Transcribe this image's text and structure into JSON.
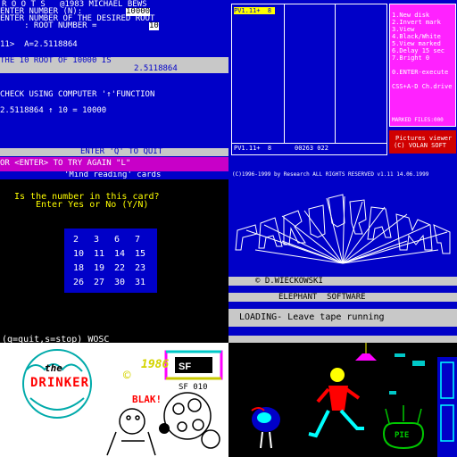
{
  "roots": {
    "title": "R O O T S   @1983 MICHAEL BEWS",
    "line_n_label": "ENTER NUMBER (N):",
    "line_n_value": "10000",
    "line_root_label": "ENTER NUMBER OF THE DESIRED ROOT",
    "line_root_label2": "     : ROOT NUMBER =",
    "line_root_value": "10",
    "result_line": "11>  A=2.5118864",
    "band1": "THE 10 ROOT OF 10000 IS",
    "band2": "2.5118864",
    "check": "CHECK USING COMPUTER '↑'FUNCTION",
    "check_result": "2.5118864 ↑ 10 = 10000",
    "quit": "ENTER 'Q' TO QUIT",
    "again": "OR <ENTER> TO TRY AGAIN \"L\""
  },
  "viewer": {
    "header": "PV1.11+  8",
    "footer_left": "PV1.11+  8",
    "footer_right": "00263 022",
    "menu": [
      "1.New disk",
      "2.Invert mark",
      "3.View",
      "4.Black/White",
      "5.View marked",
      "6.Delay 15 sec",
      "7.Bright 0",
      "",
      "0.ENTER-execute",
      "",
      "CSS+A-D Ch.drive"
    ],
    "marked": "MARKED FILES:000",
    "title1": "Pictures viewer",
    "title2": "(C) VOLAN SOFT"
  },
  "mind": {
    "title": "'Mind reading' cards",
    "question": "Is the number in this card?",
    "prompt": "Enter Yes or No (Y/N)",
    "numbers": [
      [
        "2",
        "3",
        "6",
        "7"
      ],
      [
        "10",
        "11",
        "14",
        "15"
      ],
      [
        "18",
        "19",
        "22",
        "23"
      ],
      [
        "26",
        "27",
        "30",
        "31"
      ]
    ],
    "status": "(q=quit,s=stop) WOSC"
  },
  "paragram": {
    "copyright": "(C)1996-1999 by Research ALL RIGHTS RESERVED v1.11 14.06.1999",
    "logo": "PARAGRAM",
    "author": "© D.WIECKOWSKI",
    "company": "ELEPHANT  SOFTWARE",
    "loading": "LOADING- Leave tape running"
  },
  "drinker": {
    "logo_the": "the",
    "logo_main": "DRINKER",
    "year": "1986",
    "copyright_sym": "©",
    "code": "SF 010",
    "blurb": "BLAK!"
  },
  "room": {
    "sign": "PIE"
  },
  "colors": {
    "spectrum_blue": "#0000c8",
    "spectrum_magenta": "#ff22ff",
    "spectrum_yellow": "#ffff00",
    "spectrum_cyan": "#00ffff",
    "spectrum_red": "#d00000",
    "spectrum_green": "#00c800"
  }
}
